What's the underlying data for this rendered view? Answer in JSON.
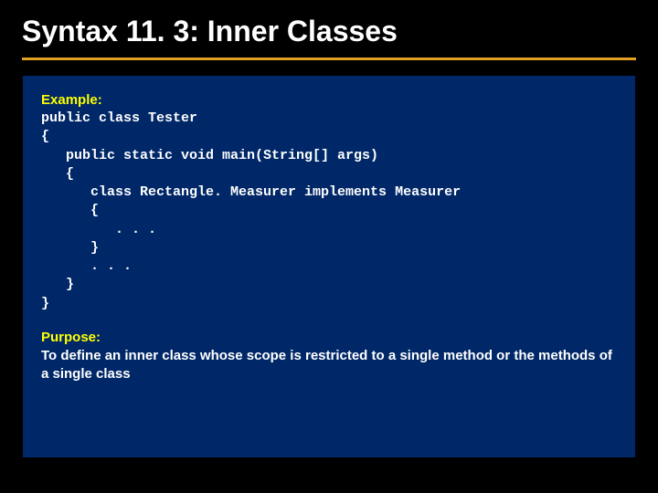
{
  "title": "Syntax 11. 3: Inner Classes",
  "example_label": "Example:",
  "code": "public class Tester\n{\n   public static void main(String[] args)\n   {\n      class Rectangle. Measurer implements Measurer\n      {\n         . . .\n      }\n      . . .\n   }\n}",
  "purpose_label": "Purpose:",
  "purpose_text": "To define an inner class whose scope is restricted to a single method or the methods of a single class"
}
